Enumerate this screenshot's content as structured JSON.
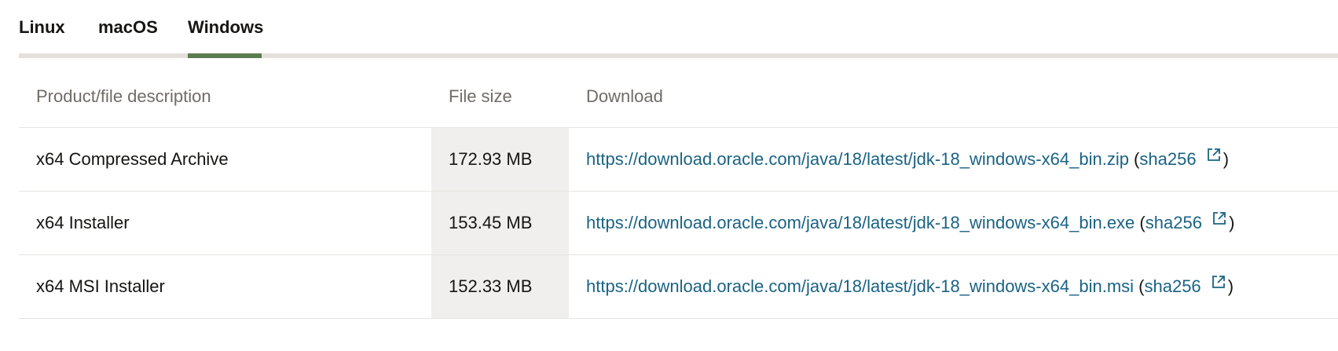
{
  "tabs": [
    {
      "label": "Linux",
      "selected": false
    },
    {
      "label": "macOS",
      "selected": false
    },
    {
      "label": "Windows",
      "selected": true
    }
  ],
  "accent_color": "#5b7c4f",
  "link_color": "#1a6384",
  "table": {
    "headers": {
      "description": "Product/file description",
      "size": "File size",
      "download": "Download"
    },
    "rows": [
      {
        "description": "x64 Compressed Archive",
        "size": "172.93 MB",
        "url": "https://download.oracle.com/java/18/latest/jdk-18_windows-x64_bin.zip",
        "checksum_label": "sha256",
        "checksum_icon": "external-link-icon"
      },
      {
        "description": "x64 Installer",
        "size": "153.45 MB",
        "url": "https://download.oracle.com/java/18/latest/jdk-18_windows-x64_bin.exe",
        "checksum_label": "sha256",
        "checksum_icon": "external-link-icon"
      },
      {
        "description": "x64 MSI Installer",
        "size": "152.33 MB",
        "url": "https://download.oracle.com/java/18/latest/jdk-18_windows-x64_bin.msi",
        "checksum_label": "sha256",
        "checksum_icon": "external-link-icon"
      }
    ]
  }
}
